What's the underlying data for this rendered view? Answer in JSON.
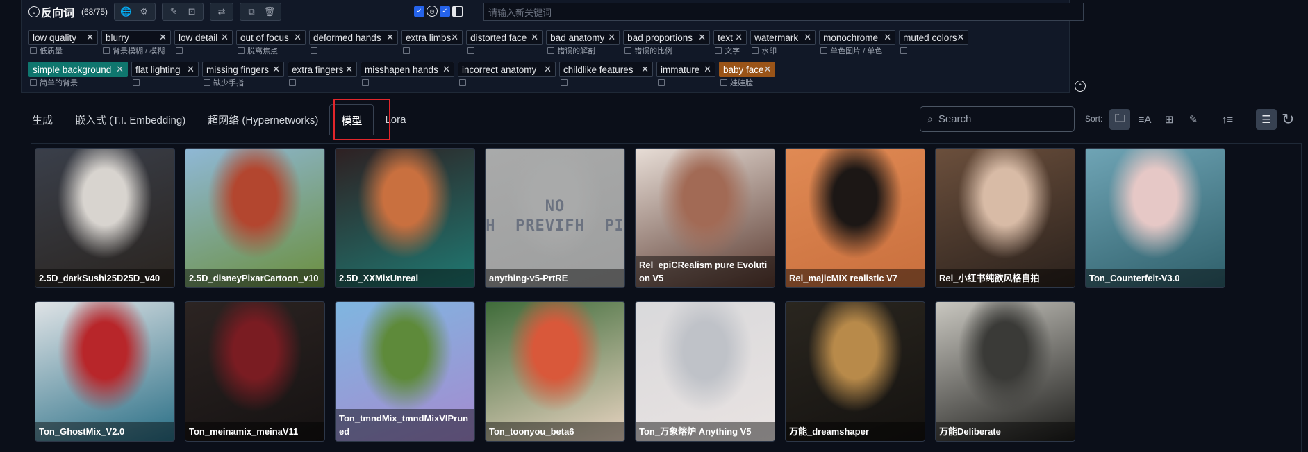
{
  "negative_panel": {
    "title": "反向词",
    "count": "(68/75)",
    "new_keyword_placeholder": "请输入新关键词",
    "tag_rows": [
      [
        {
          "en": "low quality",
          "zh": "低质量",
          "w": 100
        },
        {
          "en": "blurry",
          "zh": "背景模糊 / 模糊",
          "w": 100
        },
        {
          "en": "low detail",
          "zh": "",
          "w": 84
        },
        {
          "en": "out of focus",
          "zh": "脱离焦点",
          "w": 100
        },
        {
          "en": "deformed hands",
          "zh": "",
          "w": 128
        },
        {
          "en": "extra limbs",
          "zh": "",
          "w": 88
        },
        {
          "en": "distorted face",
          "zh": "",
          "w": 110
        },
        {
          "en": "bad anatomy",
          "zh": "错误的解剖",
          "w": 106
        },
        {
          "en": "bad proportions",
          "zh": "错误的比例",
          "w": 125
        },
        {
          "en": "text",
          "zh": "文字",
          "w": 48
        },
        {
          "en": "watermark",
          "zh": "水印",
          "w": 94
        },
        {
          "en": "monochrome",
          "zh": "单色图片 / 单色",
          "w": 110
        },
        {
          "en": "muted colors",
          "zh": "",
          "w": 100
        }
      ],
      [
        {
          "en": "simple background",
          "zh": "简单的背景",
          "w": 143,
          "style": "teal"
        },
        {
          "en": "flat lighting",
          "zh": "",
          "w": 97
        },
        {
          "en": "missing fingers",
          "zh": "缺少手指",
          "w": 118
        },
        {
          "en": "extra fingers",
          "zh": "",
          "w": 100
        },
        {
          "en": "misshapen hands",
          "zh": "",
          "w": 135
        },
        {
          "en": "incorrect anatomy",
          "zh": "",
          "w": 141
        },
        {
          "en": "childlike features",
          "zh": "",
          "w": 135
        },
        {
          "en": "immature",
          "zh": "",
          "w": 85
        },
        {
          "en": "baby face",
          "zh": "娃娃脸",
          "w": 80,
          "style": "orange"
        }
      ]
    ]
  },
  "tabs": [
    {
      "label": "生成",
      "active": false
    },
    {
      "label": "嵌入式 (T.I. Embedding)",
      "active": false
    },
    {
      "label": "超网络 (Hypernetworks)",
      "active": false
    },
    {
      "label": "模型",
      "active": true
    },
    {
      "label": "Lora",
      "active": false
    }
  ],
  "search": {
    "placeholder": "Search"
  },
  "sort_label": "Sort:",
  "no_preview_text": "NO\nPREVIFH PREVIFH PREVIFH",
  "models": [
    {
      "name": "2.5D_darkSushi25D25D_v40",
      "colors": [
        "#3a3f4a",
        "#d8d4cf",
        "#2a241f"
      ]
    },
    {
      "name": "2.5D_disneyPixarCartoon_v10",
      "colors": [
        "#8fb8d6",
        "#b3462f",
        "#6b8f3e"
      ]
    },
    {
      "name": "2.5D_XXMixUnreal",
      "colors": [
        "#2e2022",
        "#c9703f",
        "#1f7a73"
      ]
    },
    {
      "name": "anything-v5-PrtRE",
      "colors": [
        "#a9aaaa",
        "#a9aaaa",
        "#9d9e9e"
      ],
      "no_preview": true
    },
    {
      "name": "Rel_epiCRealism pure Evolution V5",
      "colors": [
        "#e7ddd6",
        "#a26a55",
        "#5a3a30"
      ]
    },
    {
      "name": "Rel_majicMIX realistic V7",
      "colors": [
        "#e08a54",
        "#1c1715",
        "#c96f3d"
      ]
    },
    {
      "name": "Rel_小红书纯欲风格自拍",
      "colors": [
        "#6b4f3c",
        "#d8bba6",
        "#2a211c"
      ]
    },
    {
      "name": "Ton_Counterfeit-V3.0",
      "colors": [
        "#6fa4b5",
        "#e6c8c6",
        "#2e5f6a"
      ]
    },
    {
      "name": "Ton_GhostMix_V2.0",
      "colors": [
        "#dfe3e6",
        "#b8262a",
        "#2a6f86"
      ]
    },
    {
      "name": "Ton_meinamix_meinaV11",
      "colors": [
        "#2c2422",
        "#7a1c22",
        "#151212"
      ]
    },
    {
      "name": "Ton_tmndMix_tmndMixVIPruned",
      "colors": [
        "#7fb6e0",
        "#5e8a3a",
        "#a58ad0"
      ]
    },
    {
      "name": "Ton_toonyou_beta6",
      "colors": [
        "#3f6c3a",
        "#d9583a",
        "#e9d4c2"
      ]
    },
    {
      "name": "Ton_万象熔炉 Anything V5",
      "colors": [
        "#d9d9db",
        "#bfc2c8",
        "#e9e3e2"
      ]
    },
    {
      "name": "万能_dreamshaper",
      "colors": [
        "#2a261f",
        "#b88a4a",
        "#141210"
      ]
    },
    {
      "name": "万能Deliberate",
      "colors": [
        "#c9c7c0",
        "#3a3a37",
        "#1c1c1a"
      ]
    }
  ]
}
